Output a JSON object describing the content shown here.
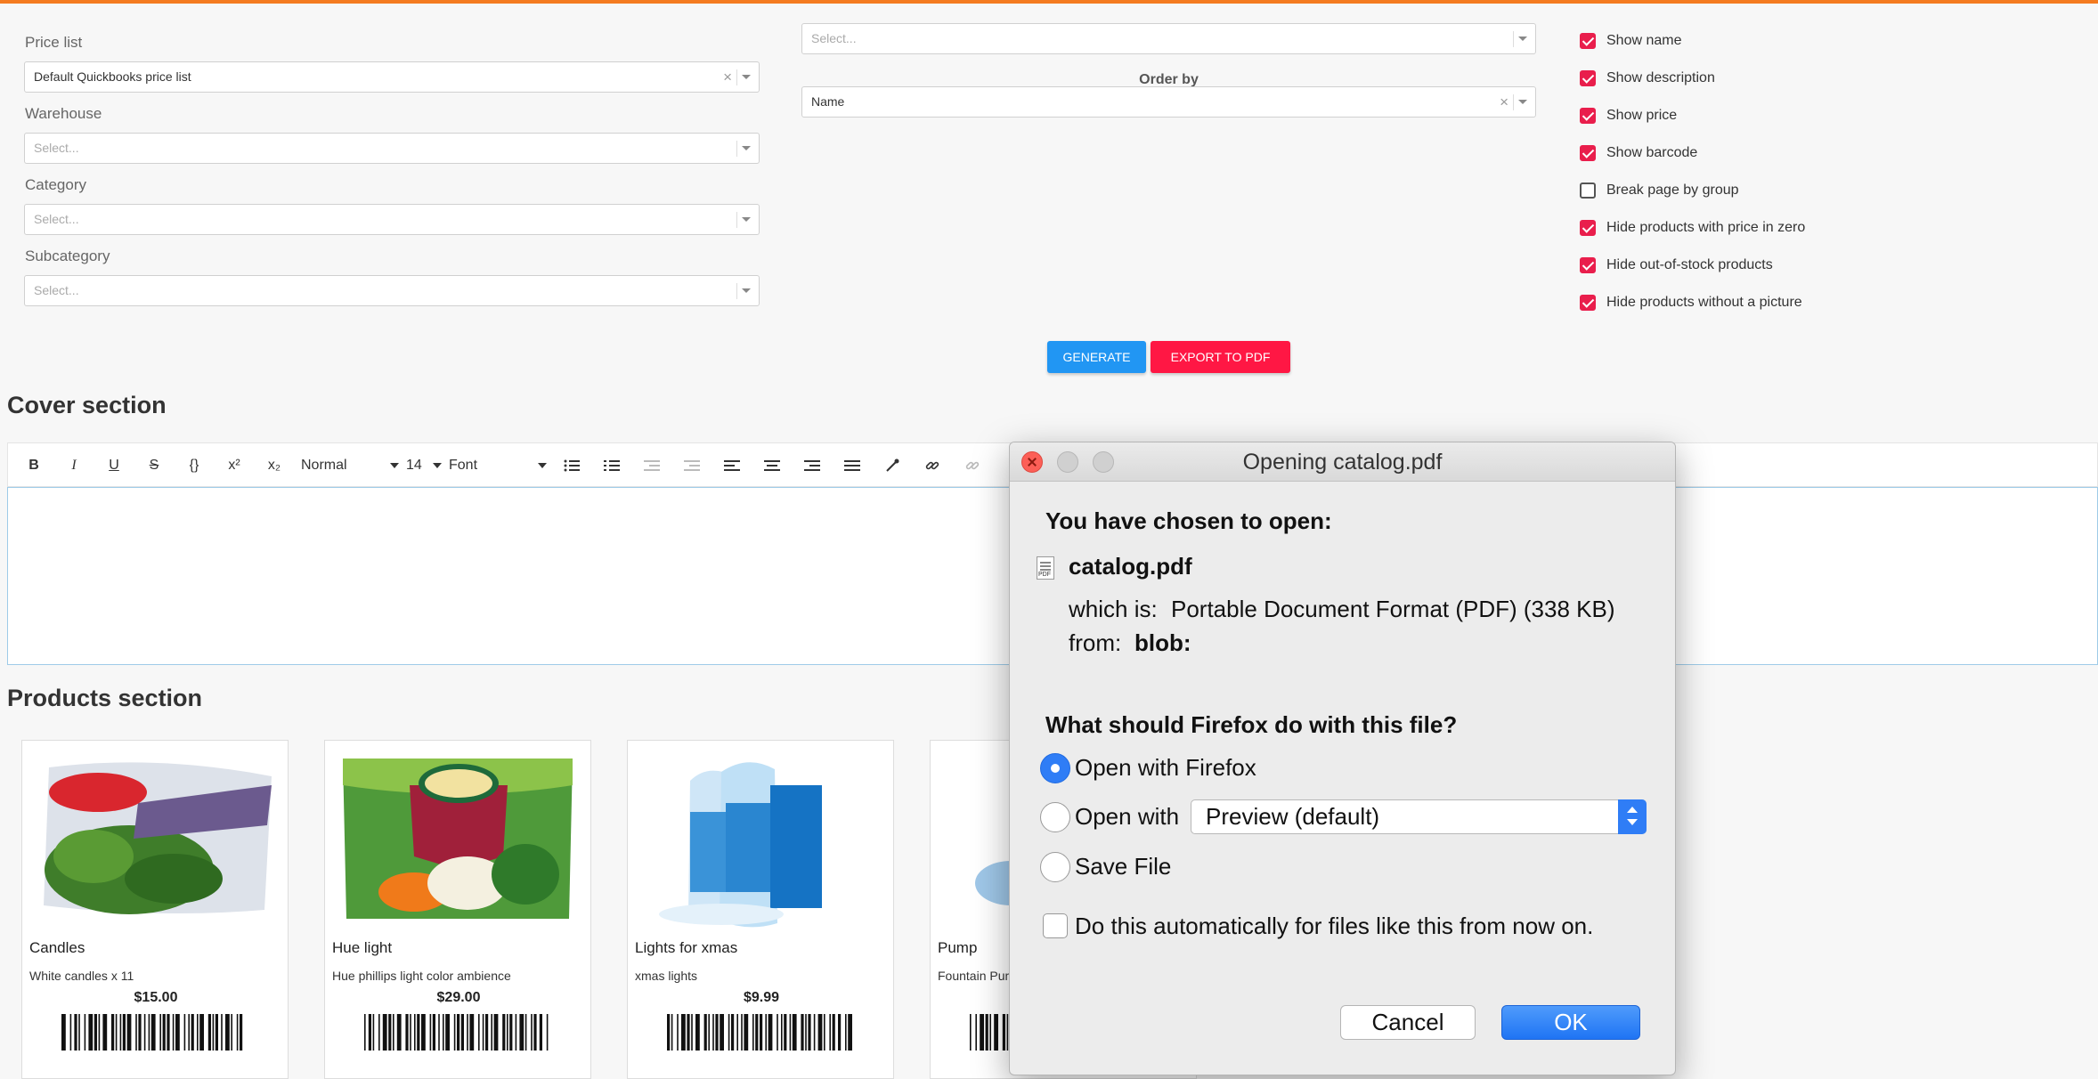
{
  "filters": {
    "price_list_label": "Price list",
    "price_list_value": "Default Quickbooks price list",
    "warehouse_label": "Warehouse",
    "warehouse_placeholder": "Select...",
    "category_label": "Category",
    "category_placeholder": "Select...",
    "subcategory_label": "Subcategory",
    "subcategory_placeholder": "Select...",
    "top_select_placeholder": "Select...",
    "order_by_label": "Order by",
    "order_by_value": "Name"
  },
  "options": [
    {
      "label": "Show name",
      "checked": true
    },
    {
      "label": "Show description",
      "checked": true
    },
    {
      "label": "Show price",
      "checked": true
    },
    {
      "label": "Show barcode",
      "checked": true
    },
    {
      "label": "Break page by group",
      "checked": false
    },
    {
      "label": "Hide products with price in zero",
      "checked": true
    },
    {
      "label": "Hide out-of-stock products",
      "checked": true
    },
    {
      "label": "Hide products without a picture",
      "checked": true
    }
  ],
  "actions": {
    "generate": "GENERATE",
    "export_pdf": "EXPORT TO PDF"
  },
  "sections": {
    "cover": "Cover section",
    "products": "Products section"
  },
  "toolbar": {
    "bold": "B",
    "italic": "I",
    "underline": "U",
    "strike": "S",
    "code": "{}",
    "superscript": "x²",
    "subscript": "x₂",
    "format": "Normal",
    "size": "14",
    "font": "Font"
  },
  "products": [
    {
      "name": "Candles",
      "desc": "White candles x 11",
      "price": "$15.00"
    },
    {
      "name": "Hue light",
      "desc": "Hue phillips light color ambience",
      "price": "$29.00"
    },
    {
      "name": "Lights for xmas",
      "desc": "xmas lights",
      "price": "$9.99"
    },
    {
      "name": "Pump",
      "desc": "Fountain Pum",
      "price": ""
    }
  ],
  "dialog": {
    "title": "Opening catalog.pdf",
    "chosen": "You have chosen to open:",
    "filename": "catalog.pdf",
    "which_is_label": "which is:",
    "which_is_value": "Portable Document Format (PDF) (338 KB)",
    "from_label": "from:",
    "from_value": "blob:",
    "question": "What should Firefox do with this file?",
    "open_with_firefox": "Open with Firefox",
    "open_with": "Open with",
    "open_with_app": "Preview (default)",
    "save_file": "Save File",
    "auto": "Do this automatically for files like this from now on.",
    "cancel": "Cancel",
    "ok": "OK",
    "pdf_icon_text": "PDF"
  },
  "colors": {
    "accent_orange": "#f47b20",
    "check_red": "#e91e4c",
    "generate_blue": "#2196f3",
    "export_red": "#ff1744",
    "mac_blue": "#2f7df6"
  }
}
